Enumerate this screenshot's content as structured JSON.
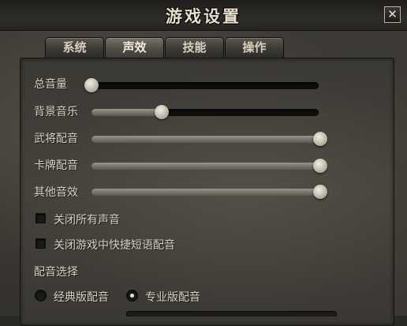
{
  "window": {
    "title": "游戏设置",
    "close_symbol": "✕"
  },
  "tabs": [
    {
      "label": "系统",
      "active": false
    },
    {
      "label": "声效",
      "active": true
    },
    {
      "label": "技能",
      "active": false
    },
    {
      "label": "操作",
      "active": false
    }
  ],
  "sliders": [
    {
      "label": "总音量",
      "value": 0.0
    },
    {
      "label": "背景音乐",
      "value": 0.31
    },
    {
      "label": "武将配音",
      "value": 1.0
    },
    {
      "label": "卡牌配音",
      "value": 1.0
    },
    {
      "label": "其他音效",
      "value": 1.0
    }
  ],
  "checkboxes": [
    {
      "label": "关闭所有声音",
      "checked": false
    },
    {
      "label": "关闭游戏中快捷短语配音",
      "checked": false
    }
  ],
  "voice_select": {
    "heading": "配音选择",
    "options": [
      {
        "label": "经典版配音",
        "selected": false
      },
      {
        "label": "专业版配音",
        "selected": true
      }
    ]
  },
  "colors": {
    "text": "#d9d3c2",
    "title": "#e8e0cc",
    "track": "#0d0d0c",
    "fill": "#8a857a"
  }
}
